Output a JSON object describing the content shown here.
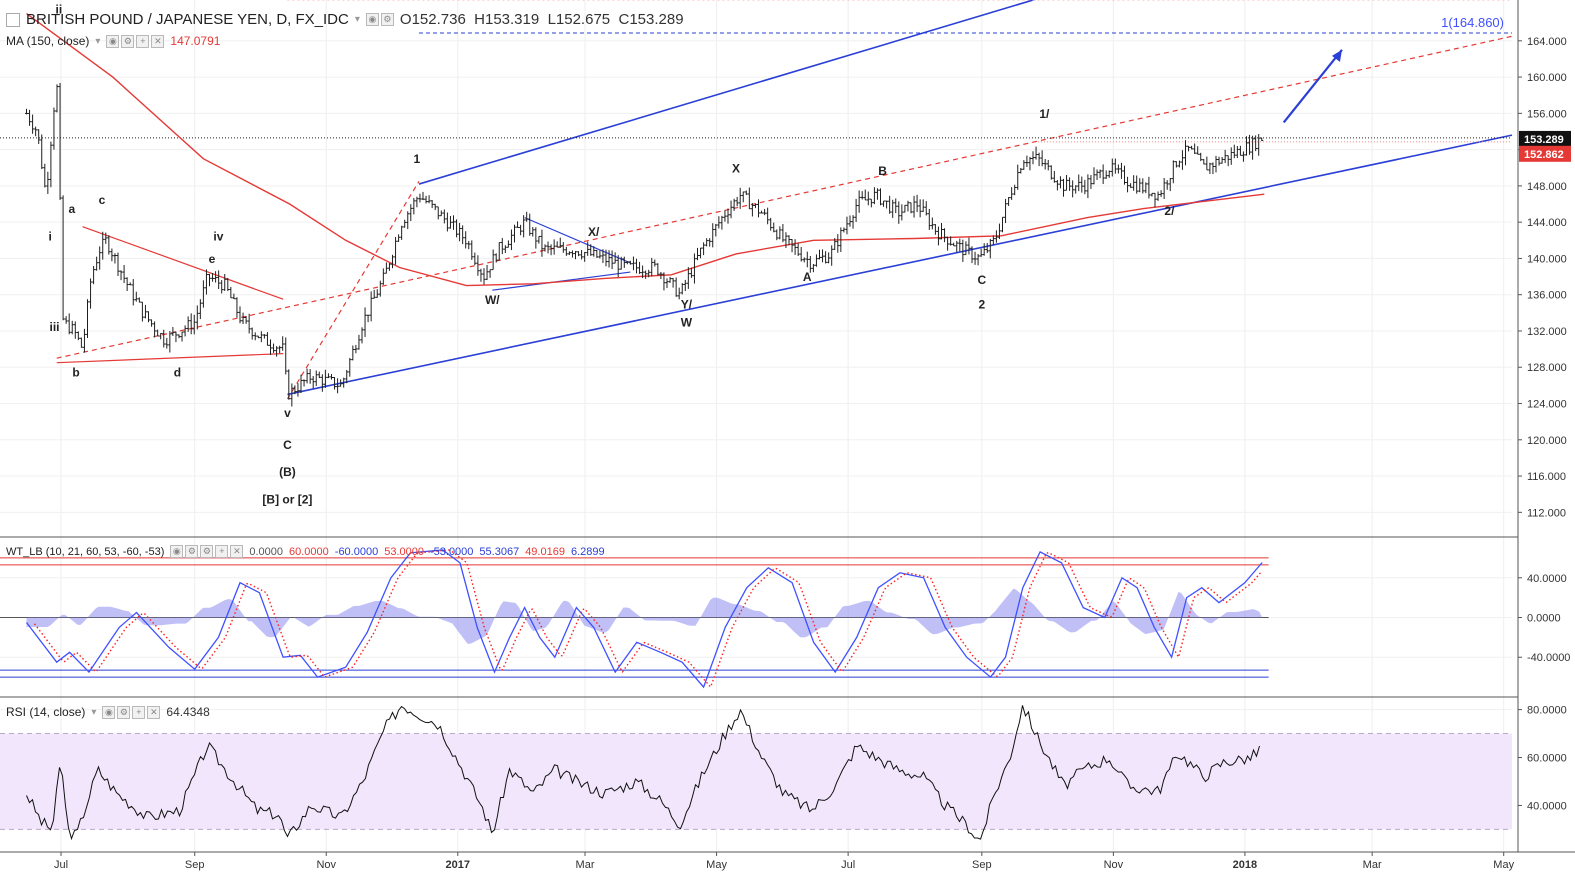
{
  "header": {
    "symbol": "BRITISH POUND / JAPANESE YEN, D, FX_IDC",
    "open_label": "O",
    "open": "152.736",
    "high_label": "H",
    "high": "153.319",
    "low_label": "L",
    "low": "152.675",
    "close_label": "C",
    "close": "153.289"
  },
  "ma_legend": {
    "title": "MA (150, close)",
    "value": "147.0791"
  },
  "wt_legend": {
    "title": "WT_LB (10, 21, 60, 53, -60, -53)",
    "values": [
      "0.0000",
      "60.0000",
      "-60.0000",
      "53.0000",
      "-53.0000",
      "55.3067",
      "49.0169",
      "6.2899"
    ]
  },
  "rsi_legend": {
    "title": "RSI (14, close)",
    "value": "64.4348"
  },
  "price_badges": {
    "last": "153.289",
    "ma": "152.862"
  },
  "target_label": "1(164.860)",
  "colors": {
    "candles": "#1f1f1f",
    "ma": "#e53935",
    "channel": "#2a3fd6",
    "wt1": "#3f51ff",
    "wt2": "#ff1f1f",
    "wt_hist": "#8c8cf0",
    "rsi": "#111111",
    "rsi_band": "#f1e6fb"
  },
  "chart_data": [
    {
      "type": "candlestick",
      "title": "BRITISH POUND / JAPANESE YEN, D, FX_IDC",
      "y_ticks": [
        "164.000",
        "160.000",
        "156.000",
        "152.000",
        "148.000",
        "144.000",
        "140.000",
        "136.000",
        "132.000",
        "128.000",
        "124.000",
        "120.000",
        "116.000",
        "112.000"
      ],
      "ylim": [
        109.5,
        168.5
      ],
      "x_ticks": [
        "Jul",
        "Sep",
        "Nov",
        "2017",
        "Mar",
        "May",
        "Jul",
        "Sep",
        "Nov",
        "2018",
        "Mar",
        "May"
      ],
      "price_path": [
        {
          "x": "2016-06-15",
          "y": 156
        },
        {
          "x": "2016-06-20",
          "y": 154
        },
        {
          "x": "2016-06-24",
          "y": 147
        },
        {
          "x": "2016-06-29",
          "y": 160
        },
        {
          "x": "2016-07-02",
          "y": 133
        },
        {
          "x": "2016-07-07",
          "y": 132
        },
        {
          "x": "2016-07-11",
          "y": 130
        },
        {
          "x": "2016-07-15",
          "y": 138
        },
        {
          "x": "2016-07-19",
          "y": 141
        },
        {
          "x": "2016-07-22",
          "y": 142
        },
        {
          "x": "2016-08-01",
          "y": 137
        },
        {
          "x": "2016-08-08",
          "y": 134
        },
        {
          "x": "2016-08-18",
          "y": 131
        },
        {
          "x": "2016-09-01",
          "y": 133
        },
        {
          "x": "2016-09-07",
          "y": 138
        },
        {
          "x": "2016-09-15",
          "y": 137
        },
        {
          "x": "2016-09-23",
          "y": 133
        },
        {
          "x": "2016-10-03",
          "y": 131
        },
        {
          "x": "2016-10-12",
          "y": 130
        },
        {
          "x": "2016-10-14",
          "y": 125
        },
        {
          "x": "2016-10-25",
          "y": 127
        },
        {
          "x": "2016-11-08",
          "y": 126
        },
        {
          "x": "2016-11-18",
          "y": 133
        },
        {
          "x": "2016-11-28",
          "y": 138
        },
        {
          "x": "2016-12-06",
          "y": 144
        },
        {
          "x": "2016-12-14",
          "y": 147
        },
        {
          "x": "2016-12-23",
          "y": 145
        },
        {
          "x": "2017-01-05",
          "y": 142
        },
        {
          "x": "2017-01-13",
          "y": 138
        },
        {
          "x": "2017-01-20",
          "y": 141
        },
        {
          "x": "2017-02-01",
          "y": 144
        },
        {
          "x": "2017-02-10",
          "y": 141
        },
        {
          "x": "2017-02-24",
          "y": 141
        },
        {
          "x": "2017-03-09",
          "y": 140
        },
        {
          "x": "2017-03-21",
          "y": 139
        },
        {
          "x": "2017-04-03",
          "y": 139
        },
        {
          "x": "2017-04-14",
          "y": 136
        },
        {
          "x": "2017-04-24",
          "y": 141
        },
        {
          "x": "2017-05-05",
          "y": 145
        },
        {
          "x": "2017-05-12",
          "y": 147
        },
        {
          "x": "2017-05-22",
          "y": 145
        },
        {
          "x": "2017-06-01",
          "y": 142
        },
        {
          "x": "2017-06-14",
          "y": 139.5
        },
        {
          "x": "2017-06-23",
          "y": 140.5
        },
        {
          "x": "2017-07-05",
          "y": 146
        },
        {
          "x": "2017-07-14",
          "y": 147
        },
        {
          "x": "2017-07-24",
          "y": 145
        },
        {
          "x": "2017-08-02",
          "y": 146
        },
        {
          "x": "2017-08-11",
          "y": 143
        },
        {
          "x": "2017-08-23",
          "y": 141
        },
        {
          "x": "2017-08-31",
          "y": 140
        },
        {
          "x": "2017-09-07",
          "y": 142
        },
        {
          "x": "2017-09-14",
          "y": 147
        },
        {
          "x": "2017-09-20",
          "y": 151
        },
        {
          "x": "2017-09-27",
          "y": 151
        },
        {
          "x": "2017-10-09",
          "y": 148
        },
        {
          "x": "2017-10-18",
          "y": 148
        },
        {
          "x": "2017-10-30",
          "y": 150
        },
        {
          "x": "2017-11-08",
          "y": 148.5
        },
        {
          "x": "2017-11-22",
          "y": 147
        },
        {
          "x": "2017-12-01",
          "y": 151
        },
        {
          "x": "2017-12-06",
          "y": 152
        },
        {
          "x": "2017-12-13",
          "y": 150
        },
        {
          "x": "2017-12-22",
          "y": 151
        },
        {
          "x": "2018-01-04",
          "y": 152.5
        },
        {
          "x": "2018-01-09",
          "y": 153.3
        }
      ],
      "ma150": [
        {
          "x": "2016-06-15",
          "y": 167
        },
        {
          "x": "2016-07-25",
          "y": 160
        },
        {
          "x": "2016-09-05",
          "y": 151
        },
        {
          "x": "2016-10-15",
          "y": 146
        },
        {
          "x": "2016-11-10",
          "y": 142
        },
        {
          "x": "2016-12-05",
          "y": 139
        },
        {
          "x": "2017-01-05",
          "y": 137
        },
        {
          "x": "2017-02-05",
          "y": 137.2
        },
        {
          "x": "2017-03-10",
          "y": 137.8
        },
        {
          "x": "2017-04-10",
          "y": 138.2
        },
        {
          "x": "2017-05-10",
          "y": 140.5
        },
        {
          "x": "2017-06-15",
          "y": 142
        },
        {
          "x": "2017-08-01",
          "y": 142.2
        },
        {
          "x": "2017-09-10",
          "y": 142.5
        },
        {
          "x": "2017-10-20",
          "y": 144.5
        },
        {
          "x": "2017-11-15",
          "y": 145.5
        },
        {
          "x": "2018-01-10",
          "y": 147.08
        }
      ],
      "annotations": [
        "i",
        "ii",
        "iii",
        "iv",
        "v",
        "a",
        "b",
        "c",
        "d",
        "e",
        "C",
        "(B)",
        "[B] or [2]",
        "1",
        "W/",
        "X/",
        "Y/",
        "W",
        "X",
        "A",
        "B",
        "C",
        "2",
        "1/",
        "2/"
      ],
      "target": 164.86
    },
    {
      "type": "line",
      "title": "WT_LB (10, 21, 60, 53, -60, -53)",
      "y_ticks": [
        "40.0000",
        "0.0000",
        "-40.0000"
      ],
      "ylim": [
        -78,
        78
      ],
      "levels": [
        60,
        53,
        -53,
        -60
      ],
      "wt1": [
        {
          "x": "2016-06-15",
          "y": -5
        },
        {
          "x": "2016-06-29",
          "y": -45
        },
        {
          "x": "2016-07-05",
          "y": -35
        },
        {
          "x": "2016-07-14",
          "y": -55
        },
        {
          "x": "2016-07-28",
          "y": -10
        },
        {
          "x": "2016-08-05",
          "y": 5
        },
        {
          "x": "2016-08-20",
          "y": -30
        },
        {
          "x": "2016-09-01",
          "y": -52
        },
        {
          "x": "2016-09-12",
          "y": -20
        },
        {
          "x": "2016-09-22",
          "y": 35
        },
        {
          "x": "2016-10-01",
          "y": 25
        },
        {
          "x": "2016-10-12",
          "y": -40
        },
        {
          "x": "2016-10-20",
          "y": -38
        },
        {
          "x": "2016-10-28",
          "y": -60
        },
        {
          "x": "2016-11-10",
          "y": -50
        },
        {
          "x": "2016-11-20",
          "y": -15
        },
        {
          "x": "2016-12-01",
          "y": 40
        },
        {
          "x": "2016-12-10",
          "y": 65
        },
        {
          "x": "2016-12-25",
          "y": 68
        },
        {
          "x": "2017-01-02",
          "y": 55
        },
        {
          "x": "2017-01-10",
          "y": -10
        },
        {
          "x": "2017-01-18",
          "y": -55
        },
        {
          "x": "2017-01-25",
          "y": -20
        },
        {
          "x": "2017-02-01",
          "y": 10
        },
        {
          "x": "2017-02-08",
          "y": -20
        },
        {
          "x": "2017-02-15",
          "y": -40
        },
        {
          "x": "2017-02-25",
          "y": 10
        },
        {
          "x": "2017-03-05",
          "y": -10
        },
        {
          "x": "2017-03-15",
          "y": -55
        },
        {
          "x": "2017-03-25",
          "y": -25
        },
        {
          "x": "2017-04-05",
          "y": -35
        },
        {
          "x": "2017-04-15",
          "y": -45
        },
        {
          "x": "2017-04-25",
          "y": -70
        },
        {
          "x": "2017-05-05",
          "y": -10
        },
        {
          "x": "2017-05-15",
          "y": 30
        },
        {
          "x": "2017-05-25",
          "y": 50
        },
        {
          "x": "2017-06-05",
          "y": 35
        },
        {
          "x": "2017-06-15",
          "y": -25
        },
        {
          "x": "2017-06-25",
          "y": -55
        },
        {
          "x": "2017-07-05",
          "y": -20
        },
        {
          "x": "2017-07-15",
          "y": 30
        },
        {
          "x": "2017-07-25",
          "y": 45
        },
        {
          "x": "2017-08-05",
          "y": 40
        },
        {
          "x": "2017-08-15",
          "y": -10
        },
        {
          "x": "2017-08-25",
          "y": -40
        },
        {
          "x": "2017-09-05",
          "y": -60
        },
        {
          "x": "2017-09-12",
          "y": -40
        },
        {
          "x": "2017-09-20",
          "y": 30
        },
        {
          "x": "2017-09-28",
          "y": 66
        },
        {
          "x": "2017-10-08",
          "y": 55
        },
        {
          "x": "2017-10-18",
          "y": 10
        },
        {
          "x": "2017-10-28",
          "y": 0
        },
        {
          "x": "2017-11-05",
          "y": 40
        },
        {
          "x": "2017-11-12",
          "y": 30
        },
        {
          "x": "2017-11-20",
          "y": -10
        },
        {
          "x": "2017-11-28",
          "y": -40
        },
        {
          "x": "2017-12-05",
          "y": 20
        },
        {
          "x": "2017-12-12",
          "y": 30
        },
        {
          "x": "2017-12-20",
          "y": 15
        },
        {
          "x": "2018-01-01",
          "y": 35
        },
        {
          "x": "2018-01-09",
          "y": 55.31
        }
      ],
      "wt2_last": 49.0169,
      "hist_last": 6.2899
    },
    {
      "type": "line",
      "title": "RSI (14, close)",
      "y_ticks": [
        "80.0000",
        "60.0000",
        "40.0000"
      ],
      "ylim": [
        21,
        84
      ],
      "band": [
        30,
        70
      ],
      "values": [
        {
          "x": "2016-06-15",
          "y": 45
        },
        {
          "x": "2016-06-22",
          "y": 33
        },
        {
          "x": "2016-06-27",
          "y": 30
        },
        {
          "x": "2016-07-01",
          "y": 60
        },
        {
          "x": "2016-07-04",
          "y": 30
        },
        {
          "x": "2016-07-08",
          "y": 27
        },
        {
          "x": "2016-07-18",
          "y": 55
        },
        {
          "x": "2016-07-27",
          "y": 45
        },
        {
          "x": "2016-08-10",
          "y": 35
        },
        {
          "x": "2016-08-25",
          "y": 38
        },
        {
          "x": "2016-09-07",
          "y": 65
        },
        {
          "x": "2016-09-15",
          "y": 55
        },
        {
          "x": "2016-09-30",
          "y": 38
        },
        {
          "x": "2016-10-10",
          "y": 36
        },
        {
          "x": "2016-10-14",
          "y": 26
        },
        {
          "x": "2016-10-25",
          "y": 40
        },
        {
          "x": "2016-11-08",
          "y": 35
        },
        {
          "x": "2016-11-18",
          "y": 50
        },
        {
          "x": "2016-11-28",
          "y": 72
        },
        {
          "x": "2016-12-06",
          "y": 82
        },
        {
          "x": "2016-12-14",
          "y": 78
        },
        {
          "x": "2016-12-23",
          "y": 74
        },
        {
          "x": "2017-01-05",
          "y": 52
        },
        {
          "x": "2017-01-13",
          "y": 38
        },
        {
          "x": "2017-01-17",
          "y": 28
        },
        {
          "x": "2017-01-25",
          "y": 55
        },
        {
          "x": "2017-02-05",
          "y": 45
        },
        {
          "x": "2017-02-15",
          "y": 55
        },
        {
          "x": "2017-02-25",
          "y": 50
        },
        {
          "x": "2017-03-10",
          "y": 45
        },
        {
          "x": "2017-03-25",
          "y": 50
        },
        {
          "x": "2017-04-05",
          "y": 42
        },
        {
          "x": "2017-04-14",
          "y": 32
        },
        {
          "x": "2017-04-24",
          "y": 52
        },
        {
          "x": "2017-05-05",
          "y": 70
        },
        {
          "x": "2017-05-12",
          "y": 80
        },
        {
          "x": "2017-05-22",
          "y": 60
        },
        {
          "x": "2017-06-01",
          "y": 45
        },
        {
          "x": "2017-06-14",
          "y": 38
        },
        {
          "x": "2017-06-25",
          "y": 48
        },
        {
          "x": "2017-07-05",
          "y": 65
        },
        {
          "x": "2017-07-14",
          "y": 60
        },
        {
          "x": "2017-07-24",
          "y": 55
        },
        {
          "x": "2017-08-05",
          "y": 52
        },
        {
          "x": "2017-08-15",
          "y": 40
        },
        {
          "x": "2017-08-25",
          "y": 32
        },
        {
          "x": "2017-08-31",
          "y": 25
        },
        {
          "x": "2017-09-07",
          "y": 45
        },
        {
          "x": "2017-09-14",
          "y": 60
        },
        {
          "x": "2017-09-20",
          "y": 82
        },
        {
          "x": "2017-09-27",
          "y": 68
        },
        {
          "x": "2017-10-09",
          "y": 48
        },
        {
          "x": "2017-10-18",
          "y": 55
        },
        {
          "x": "2017-10-30",
          "y": 60
        },
        {
          "x": "2017-11-08",
          "y": 48
        },
        {
          "x": "2017-11-22",
          "y": 46
        },
        {
          "x": "2017-12-01",
          "y": 62
        },
        {
          "x": "2017-12-06",
          "y": 58
        },
        {
          "x": "2017-12-13",
          "y": 52
        },
        {
          "x": "2017-12-22",
          "y": 58
        },
        {
          "x": "2018-01-04",
          "y": 60
        },
        {
          "x": "2018-01-09",
          "y": 64.43
        }
      ]
    }
  ]
}
